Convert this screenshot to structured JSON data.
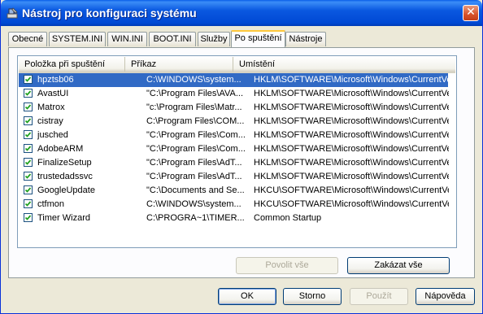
{
  "window": {
    "title": "Nástroj pro konfiguraci systému",
    "close_label": "✕"
  },
  "tabs": [
    {
      "label": "Obecné"
    },
    {
      "label": "SYSTEM.INI"
    },
    {
      "label": "WIN.INI"
    },
    {
      "label": "BOOT.INI"
    },
    {
      "label": "Služby"
    },
    {
      "label": "Po spuštění"
    },
    {
      "label": "Nástroje"
    }
  ],
  "active_tab": "Po spuštění",
  "list": {
    "columns": [
      "Položka při spuštění",
      "Příkaz",
      "Umístění"
    ],
    "rows": [
      {
        "checked": true,
        "name": "hpztsb06",
        "command": "C:\\WINDOWS\\system...",
        "location": "HKLM\\SOFTWARE\\Microsoft\\Windows\\CurrentVer...",
        "selected": true
      },
      {
        "checked": true,
        "name": "AvastUI",
        "command": "\"C:\\Program Files\\AVA...",
        "location": "HKLM\\SOFTWARE\\Microsoft\\Windows\\CurrentVer..."
      },
      {
        "checked": true,
        "name": "Matrox",
        "command": "\"c:\\Program Files\\Matr...",
        "location": "HKLM\\SOFTWARE\\Microsoft\\Windows\\CurrentVer..."
      },
      {
        "checked": true,
        "name": "cistray",
        "command": "C:\\Program Files\\COM...",
        "location": "HKLM\\SOFTWARE\\Microsoft\\Windows\\CurrentVer..."
      },
      {
        "checked": true,
        "name": "jusched",
        "command": "\"C:\\Program Files\\Com...",
        "location": "HKLM\\SOFTWARE\\Microsoft\\Windows\\CurrentVer..."
      },
      {
        "checked": true,
        "name": "AdobeARM",
        "command": "\"C:\\Program Files\\Com...",
        "location": "HKLM\\SOFTWARE\\Microsoft\\Windows\\CurrentVer..."
      },
      {
        "checked": true,
        "name": "FinalizeSetup",
        "command": "\"C:\\Program Files\\AdT...",
        "location": "HKLM\\SOFTWARE\\Microsoft\\Windows\\CurrentVer..."
      },
      {
        "checked": true,
        "name": "trustedadssvc",
        "command": "\"C:\\Program Files\\AdT...",
        "location": "HKLM\\SOFTWARE\\Microsoft\\Windows\\CurrentVer..."
      },
      {
        "checked": true,
        "name": "GoogleUpdate",
        "command": "\"C:\\Documents and Se...",
        "location": "HKCU\\SOFTWARE\\Microsoft\\Windows\\CurrentVer..."
      },
      {
        "checked": true,
        "name": "ctfmon",
        "command": "C:\\WINDOWS\\system...",
        "location": "HKCU\\SOFTWARE\\Microsoft\\Windows\\CurrentVer..."
      },
      {
        "checked": true,
        "name": "Timer Wizard",
        "command": "C:\\PROGRA~1\\TIMER...",
        "location": "Common Startup"
      }
    ]
  },
  "panel_buttons": {
    "enable_all": "Povolit vše",
    "disable_all": "Zakázat vše"
  },
  "dialog_buttons": {
    "ok": "OK",
    "cancel": "Storno",
    "apply": "Použít",
    "help": "Nápověda"
  },
  "colors": {
    "titlebar": "#0054e3",
    "selection": "#316ac5",
    "checkmark": "#21a121"
  }
}
